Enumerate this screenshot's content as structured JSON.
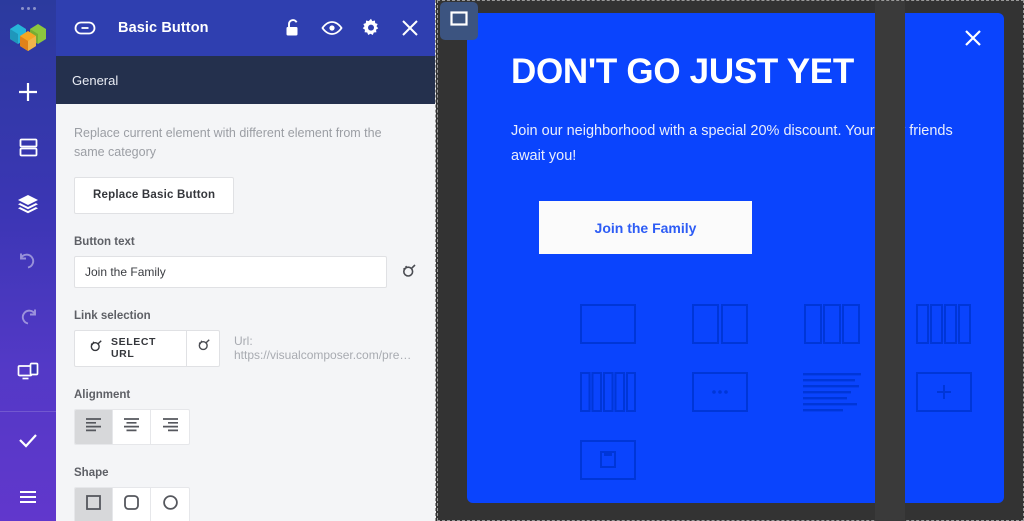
{
  "app": {
    "brand_icon": "visual-composer-logo"
  },
  "sidebar": {
    "items": [
      {
        "name": "add-element",
        "icon": "plus-icon",
        "label": "Add Element"
      },
      {
        "name": "add-template",
        "icon": "template-icon",
        "label": "Templates"
      },
      {
        "name": "layers",
        "icon": "layers-icon",
        "label": "Layers"
      },
      {
        "name": "undo",
        "icon": "undo-icon",
        "label": "Undo"
      },
      {
        "name": "redo",
        "icon": "redo-icon",
        "label": "Redo"
      },
      {
        "name": "responsive-view",
        "icon": "devices-icon",
        "label": "Responsive View"
      },
      {
        "name": "save",
        "icon": "check-icon",
        "label": "Save"
      },
      {
        "name": "menu",
        "icon": "hamburger-icon",
        "label": "Menu"
      }
    ]
  },
  "panel": {
    "header": {
      "element_icon": "basic-button-icon",
      "title": "Basic Button",
      "actions": [
        {
          "name": "lock",
          "icon": "unlock-icon"
        },
        {
          "name": "visibility",
          "icon": "eye-icon"
        },
        {
          "name": "settings",
          "icon": "gear-icon"
        },
        {
          "name": "close",
          "icon": "close-icon"
        }
      ]
    },
    "tabs": [
      {
        "label": "General",
        "active": true
      }
    ],
    "replace": {
      "description": "Replace current element with different element from the same category",
      "button_label": "Replace Basic Button"
    },
    "button_text": {
      "label": "Button text",
      "value": "Join the Family",
      "dynamic_icon": "plug-icon"
    },
    "link_selection": {
      "label": "Link selection",
      "select_label": "SELECT URL",
      "select_icon": "plug-icon",
      "dynamic_icon": "plug-icon",
      "url_text": "Url: https://visualcomposer.com/pre…"
    },
    "alignment": {
      "label": "Alignment",
      "options": [
        {
          "name": "align-left",
          "icon": "align-left-icon",
          "active": true
        },
        {
          "name": "align-center",
          "icon": "align-center-icon",
          "active": false
        },
        {
          "name": "align-right",
          "icon": "align-right-icon",
          "active": false
        }
      ]
    },
    "shape": {
      "label": "Shape",
      "options": [
        {
          "name": "shape-square",
          "icon": "square-icon",
          "active": true
        },
        {
          "name": "shape-rounded",
          "icon": "rounded-square-icon",
          "active": false
        },
        {
          "name": "shape-circle",
          "icon": "circle-icon",
          "active": false
        }
      ]
    }
  },
  "canvas": {
    "element_handle_icon": "container-square-icon",
    "popup": {
      "close_icon": "close-icon",
      "heading": "DON'T GO JUST YET",
      "body": "Join our neighborhood with a special 20% discount. Your new friends await you!",
      "cta_label": "Join the Family",
      "placeholders": [
        {
          "name": "row-1-column",
          "icon": "layout-1col-icon"
        },
        {
          "name": "row-2-columns",
          "icon": "layout-2col-icon"
        },
        {
          "name": "row-3-columns",
          "icon": "layout-3col-icon"
        },
        {
          "name": "row-4-columns",
          "icon": "layout-4col-icon"
        },
        {
          "name": "row-5-columns",
          "icon": "layout-5col-icon"
        },
        {
          "name": "add-element-placeholder",
          "icon": "dots-icon"
        },
        {
          "name": "text-block-placeholder",
          "icon": "text-lines-icon"
        },
        {
          "name": "add-row-placeholder",
          "icon": "plus-box-icon"
        },
        {
          "name": "saved-template-placeholder",
          "icon": "save-box-icon"
        }
      ]
    }
  },
  "colors": {
    "rail_top": "#2b3a9e",
    "rail_bottom": "#6137cc",
    "panel_header": "#2f3fb0",
    "panel_tabs": "#24304d",
    "panel_bg": "#f4f5f7",
    "canvas_bg": "#333333",
    "popup_bg": "#0a44fd",
    "cta_text": "#2d5cf5"
  }
}
